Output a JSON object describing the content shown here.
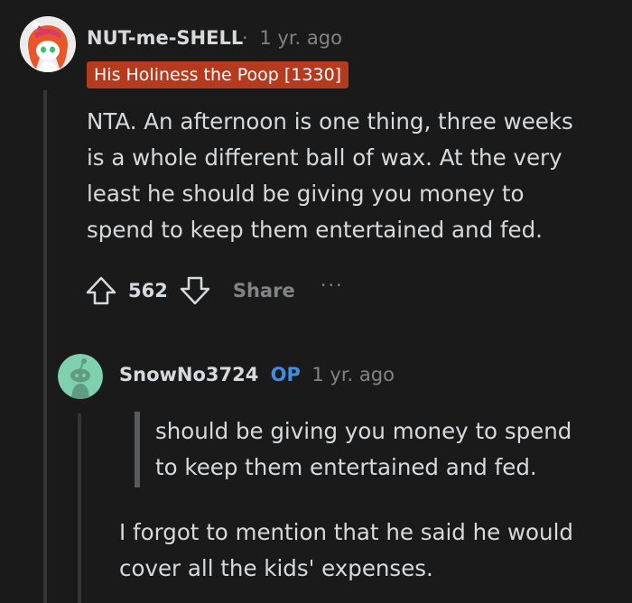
{
  "comment": {
    "username": "NUT-me-SHELL",
    "separator": "·",
    "timestamp": "1 yr. ago",
    "flair": "His Holiness the Poop [1330]",
    "body_lines": [
      "NTA. An afternoon is one thing, three weeks",
      "is a whole different ball of wax. At the very",
      "least he should be giving you money to",
      "spend to keep them entertained and fed."
    ],
    "score": "562",
    "share_label": "Share",
    "more_label": "···",
    "avatar_icon": "snoo-avatar-redhead-icon",
    "flair_color": "#b53a1e"
  },
  "reply": {
    "username": "SnowNo3724",
    "op_badge": "OP",
    "separator": "·",
    "timestamp": "1 yr. ago",
    "quote_lines": [
      "should be giving you money to spend",
      "to keep them entertained and fed."
    ],
    "body_lines": [
      "I forgot to mention that he said he would",
      "cover all the kids' expenses."
    ],
    "avatar_icon": "snoo-avatar-default-icon",
    "op_color": "#3d8fe0"
  }
}
